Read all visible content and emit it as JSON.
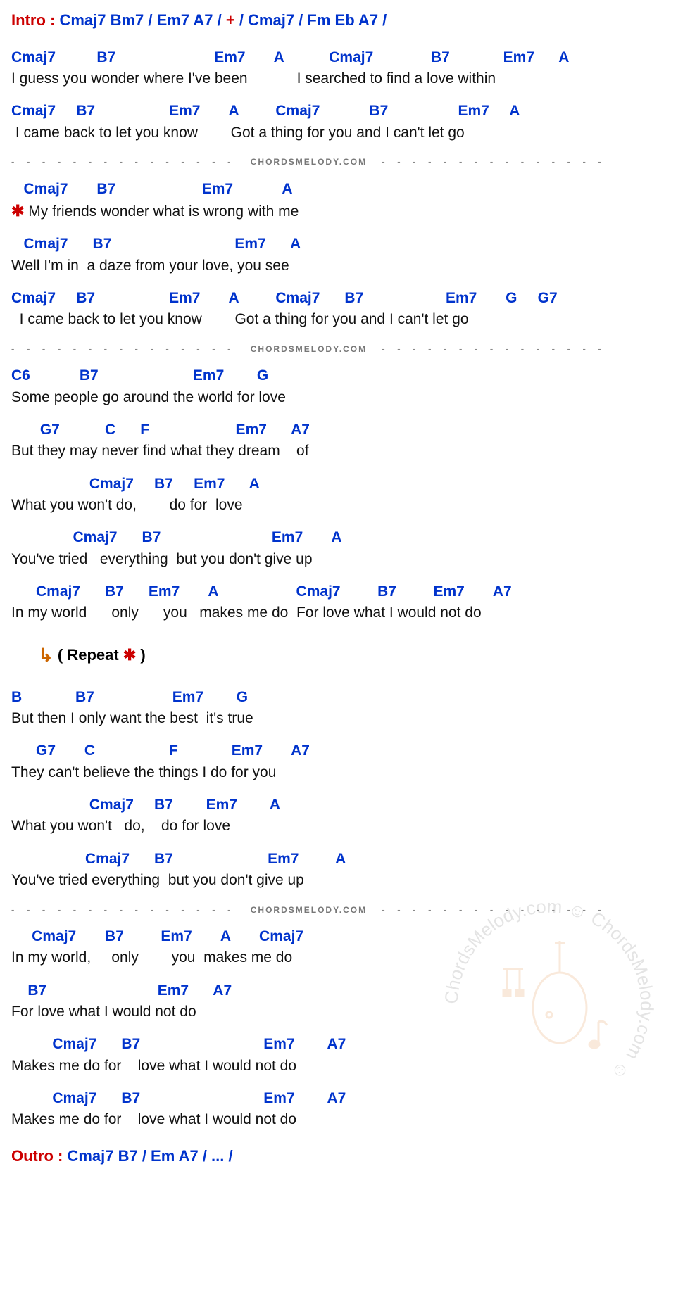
{
  "intro": {
    "label": "Intro :",
    "segment1": " Cmaj7  Bm7  /  Em7  A7  /  ",
    "plus": "+",
    "segment2": "  /  Cmaj7  /  Fm  Eb  A7  /"
  },
  "lines": [
    {
      "chords": "Cmaj7          B7                        Em7       A           Cmaj7              B7             Em7      A",
      "lyric": "I guess you wonder where I've been            I searched to find a love within"
    },
    {
      "chords": "Cmaj7     B7                  Em7       A         Cmaj7            B7                 Em7     A",
      "lyric": " I came back to let you know        Got a thing for you and I can't let go"
    }
  ],
  "sep": " - - - - - - - - - - - - - - -   C H O R D S M E L O D Y . C O M   - - - - - - - - - - - - - - - ",
  "verse2": [
    {
      "chords": "   Cmaj7       B7                     Em7            A",
      "lyric_prefix": "✱",
      "lyric": " My friends wonder what is wrong with me"
    },
    {
      "chords": "   Cmaj7      B7                              Em7      A",
      "lyric": "Well I'm in  a daze from your love, you see"
    },
    {
      "chords": "Cmaj7     B7                  Em7       A         Cmaj7      B7                    Em7       G     G7",
      "lyric": "  I came back to let you know        Got a thing for you and I can't let go"
    }
  ],
  "bridge": [
    {
      "chords": "C6            B7                       Em7        G",
      "lyric": "Some people go around the world for love"
    },
    {
      "chords": "       G7           C      F                     Em7      A7",
      "lyric": "But they may never find what they dream    of"
    },
    {
      "chords": "                   Cmaj7     B7     Em7      A",
      "lyric": "What you won't do,        do for  love"
    },
    {
      "chords": "               Cmaj7      B7                           Em7       A",
      "lyric": "You've tried   everything  but you don't give up"
    },
    {
      "chords": "      Cmaj7      B7      Em7       A                   Cmaj7         B7         Em7       A7",
      "lyric": "In my world      only      you   makes me do  For love what I would not do"
    }
  ],
  "repeat": {
    "arrow": "↳",
    "text": " ( Repeat  ",
    "star": "✱",
    "close": " )"
  },
  "verse3": [
    {
      "chords": "B             B7                   Em7        G",
      "lyric": "But then I only want the best  it's true"
    },
    {
      "chords": "      G7       C                  F             Em7       A7",
      "lyric": "They can't believe the things I do for you"
    },
    {
      "chords": "                   Cmaj7     B7        Em7        A",
      "lyric": "What you won't   do,    do for love"
    },
    {
      "chords": "                  Cmaj7      B7                       Em7         A",
      "lyric": "You've tried everything  but you don't give up"
    }
  ],
  "ending": [
    {
      "chords": "     Cmaj7       B7         Em7       A       Cmaj7",
      "lyric": "In my world,     only        you  makes me do"
    },
    {
      "chords": "    B7                           Em7      A7",
      "lyric": "For love what I would not do"
    },
    {
      "chords": "          Cmaj7      B7                              Em7        A7",
      "lyric": "Makes me do for    love what I would not do"
    },
    {
      "chords": "          Cmaj7      B7                              Em7        A7",
      "lyric": "Makes me do for    love what I would not do"
    }
  ],
  "outro": {
    "label": "Outro :",
    "chords": " Cmaj7  B7  /  Em  A7  / ...  /"
  },
  "watermark": "ChordsMelody.com"
}
